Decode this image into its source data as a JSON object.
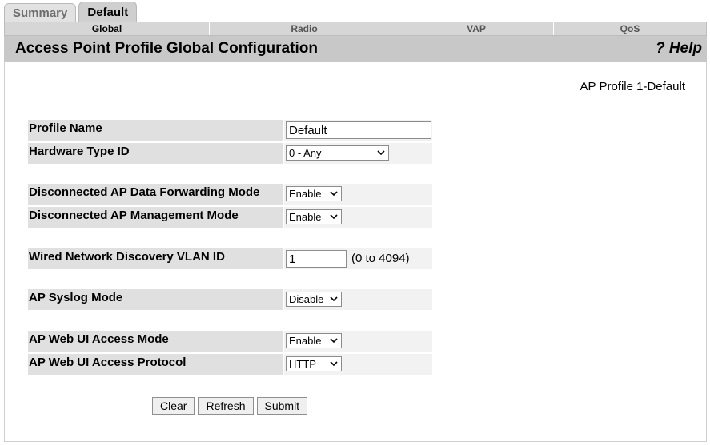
{
  "top_tabs": [
    {
      "label": "Summary"
    },
    {
      "label": "Default"
    }
  ],
  "sub_tabs": [
    {
      "label": "Global"
    },
    {
      "label": "Radio"
    },
    {
      "label": "VAP"
    },
    {
      "label": "QoS"
    }
  ],
  "header": {
    "title": "Access Point Profile Global Configuration",
    "help": "? Help"
  },
  "profile_id": "AP Profile 1-Default",
  "fields": {
    "profile_name": {
      "label": "Profile Name",
      "value": "Default"
    },
    "hardware_type": {
      "label": "Hardware Type ID",
      "value": "0 - Any"
    },
    "disc_forwarding": {
      "label": "Disconnected AP Data Forwarding Mode",
      "value": "Enable"
    },
    "disc_mgmt": {
      "label": "Disconnected AP Management Mode",
      "value": "Enable"
    },
    "vlan": {
      "label": "Wired Network Discovery VLAN ID",
      "value": "1",
      "range": "(0 to 4094)"
    },
    "syslog": {
      "label": "AP Syslog Mode",
      "value": "Disable"
    },
    "webui_mode": {
      "label": "AP Web UI Access Mode",
      "value": "Enable"
    },
    "webui_protocol": {
      "label": "AP Web UI Access Protocol",
      "value": "HTTP"
    }
  },
  "buttons": {
    "clear": "Clear",
    "refresh": "Refresh",
    "submit": "Submit"
  }
}
